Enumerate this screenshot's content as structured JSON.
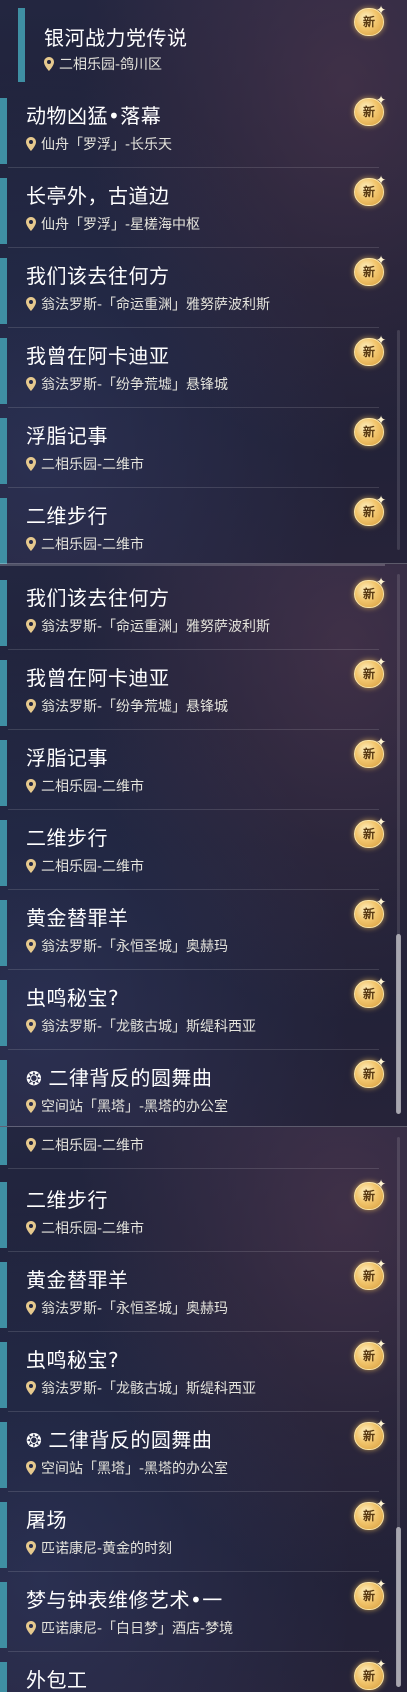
{
  "new_badge_label": "新",
  "accent_color": "#3f8fa3",
  "snapshots": [
    {
      "missions": [
        {
          "title": "银河战力党传说",
          "location": "二相乐园-鸽川区"
        },
        {
          "title": "动物凶猛•落幕",
          "location": "仙舟「罗浮」-长乐天"
        },
        {
          "title": "长亭外，古道边",
          "location": "仙舟「罗浮」-星槎海中枢"
        },
        {
          "title": "我们该去往何方",
          "location": "翁法罗斯-「命运重渊」雅努萨波利斯"
        },
        {
          "title": "我曾在阿卡迪亚",
          "location": "翁法罗斯-「纷争荒墟」悬锋城"
        },
        {
          "title": "浮脂记事",
          "location": "二相乐园-二维市"
        },
        {
          "title": "二维步行",
          "location": "二相乐园-二维市"
        }
      ]
    },
    {
      "missions": [
        {
          "title": "我们该去往何方",
          "location": "翁法罗斯-「命运重渊」雅努萨波利斯"
        },
        {
          "title": "我曾在阿卡迪亚",
          "location": "翁法罗斯-「纷争荒墟」悬锋城"
        },
        {
          "title": "浮脂记事",
          "location": "二相乐园-二维市"
        },
        {
          "title": "二维步行",
          "location": "二相乐园-二维市"
        },
        {
          "title": "黄金替罪羊",
          "location": "翁法罗斯-「永恒圣城」奥赫玛"
        },
        {
          "title": "虫鸣秘宝?",
          "location": "翁法罗斯-「龙骸古城」斯缇科西亚"
        },
        {
          "title": "二律背反的圆舞曲",
          "location": "空间站「黑塔」-黑塔的办公室"
        }
      ]
    },
    {
      "missions": [
        {
          "title": "",
          "location": "二相乐园-二维市"
        },
        {
          "title": "二维步行",
          "location": "二相乐园-二维市"
        },
        {
          "title": "黄金替罪羊",
          "location": "翁法罗斯-「永恒圣城」奥赫玛"
        },
        {
          "title": "虫鸣秘宝?",
          "location": "翁法罗斯-「龙骸古城」斯缇科西亚"
        },
        {
          "title": "二律背反的圆舞曲",
          "location": "空间站「黑塔」-黑塔的办公室"
        },
        {
          "title": "屠场",
          "location": "匹诺康尼-黄金的时刻"
        },
        {
          "title": "梦与钟表维修艺术•一",
          "location": "匹诺康尼-「白日梦」酒店-梦境"
        },
        {
          "title": "外包工",
          "location": ""
        }
      ]
    }
  ]
}
